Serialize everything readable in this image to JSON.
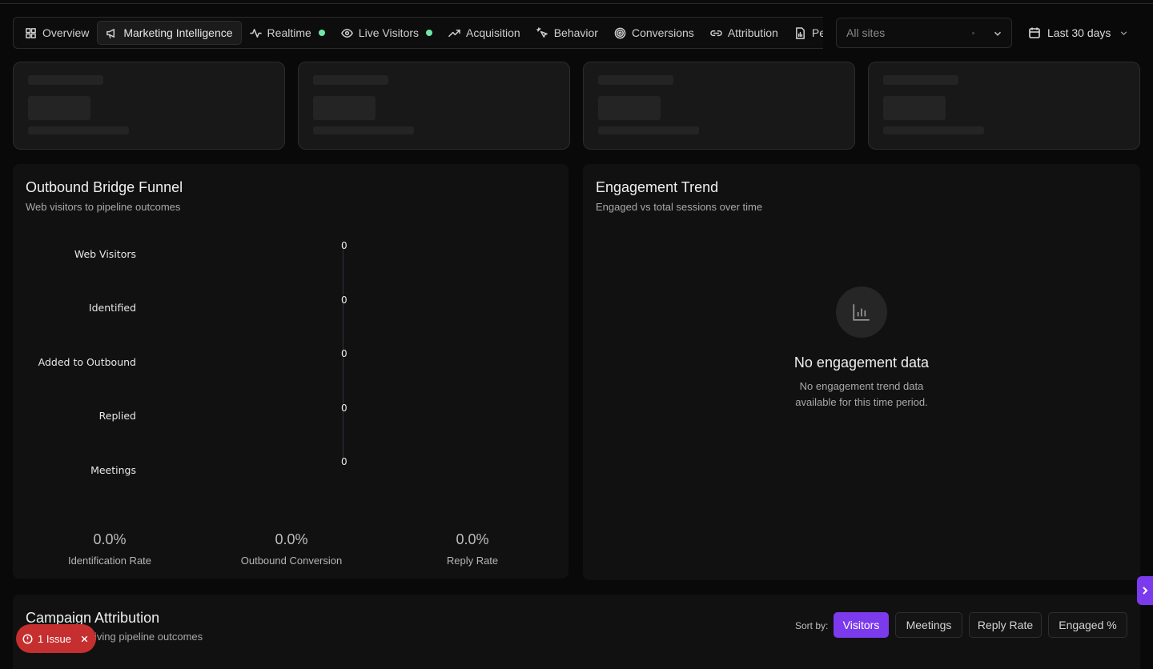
{
  "nav": {
    "tabs": [
      {
        "label": "Overview",
        "icon": "grid-icon",
        "active": false,
        "live": false
      },
      {
        "label": "Marketing Intelligence",
        "icon": "megaphone-icon",
        "active": true,
        "live": false
      },
      {
        "label": "Realtime",
        "icon": "activity-icon",
        "active": false,
        "live": true
      },
      {
        "label": "Live Visitors",
        "icon": "eye-icon",
        "active": false,
        "live": true
      },
      {
        "label": "Acquisition",
        "icon": "trending-up-icon",
        "active": false,
        "live": false
      },
      {
        "label": "Behavior",
        "icon": "pointer-icon",
        "active": false,
        "live": false
      },
      {
        "label": "Conversions",
        "icon": "target-icon",
        "active": false,
        "live": false
      },
      {
        "label": "Attribution",
        "icon": "link-icon",
        "active": false,
        "live": false
      },
      {
        "label": "Perform",
        "icon": "file-chart-icon",
        "active": false,
        "live": false
      }
    ],
    "live_color": "#6ee7a8"
  },
  "filters": {
    "site_placeholder": "All sites",
    "date_range": "Last 30 days"
  },
  "funnel": {
    "title": "Outbound Bridge Funnel",
    "subtitle": "Web visitors to pipeline outcomes",
    "stages": [
      {
        "label": "Web Visitors",
        "value": "0"
      },
      {
        "label": "Identified",
        "value": "0"
      },
      {
        "label": "Added to Outbound",
        "value": "0"
      },
      {
        "label": "Replied",
        "value": "0"
      },
      {
        "label": "Meetings",
        "value": "0"
      }
    ],
    "stats": [
      {
        "value": "0.0%",
        "label": "Identification Rate"
      },
      {
        "value": "0.0%",
        "label": "Outbound Conversion"
      },
      {
        "value": "0.0%",
        "label": "Reply Rate"
      }
    ]
  },
  "engagement": {
    "title": "Engagement Trend",
    "subtitle": "Engaged vs total sessions over time",
    "empty_title": "No engagement data",
    "empty_desc": "No engagement trend data available for this time period."
  },
  "campaign": {
    "title": "Campaign Attribution",
    "subtitle_visible": "iving pipeline outcomes",
    "sort_label": "Sort by:",
    "sort_options": [
      "Visitors",
      "Meetings",
      "Reply Rate",
      "Engaged %"
    ],
    "sort_active": "Visitors",
    "accent": "#7c3aed"
  },
  "issue_badge": {
    "label": "1 Issue",
    "color": "#c62f2f"
  }
}
